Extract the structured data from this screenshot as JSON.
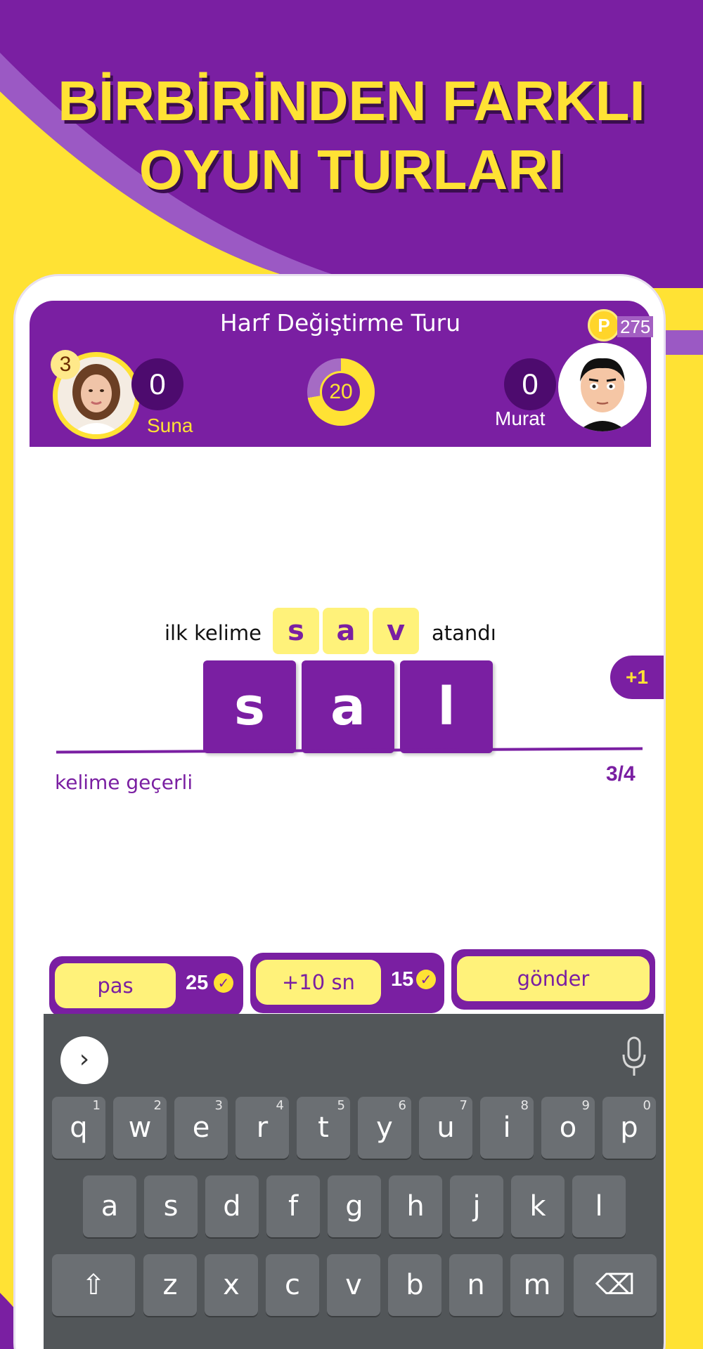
{
  "headline": {
    "line1": "BİRBİRİNDEN FARKLI",
    "line2": "OYUN TURLARI"
  },
  "game": {
    "round_title": "Harf Değiştirme Turu",
    "coin_symbol": "P",
    "coins": "275",
    "timer": "20",
    "player_left": {
      "name": "Suna",
      "score": "0",
      "level": "3"
    },
    "player_right": {
      "name": "Murat",
      "score": "0"
    }
  },
  "word": {
    "prompt_prefix": "ilk kelime",
    "prompt_suffix": "atandı",
    "first_word": [
      "s",
      "a",
      "v"
    ],
    "current_word": [
      "s",
      "a",
      "l"
    ],
    "bonus": "+1",
    "status": "kelime geçerli",
    "progress": "3/4"
  },
  "actions": {
    "pass": {
      "label": "pas",
      "cost": "25"
    },
    "extra_time": {
      "label": "+10 sn",
      "cost": "15"
    },
    "submit": {
      "label": "gönder"
    }
  },
  "keyboard": {
    "expand_glyph": "›",
    "row1": [
      {
        "k": "q",
        "h": "1"
      },
      {
        "k": "w",
        "h": "2"
      },
      {
        "k": "e",
        "h": "3"
      },
      {
        "k": "r",
        "h": "4"
      },
      {
        "k": "t",
        "h": "5"
      },
      {
        "k": "y",
        "h": "6"
      },
      {
        "k": "u",
        "h": "7"
      },
      {
        "k": "i",
        "h": "8"
      },
      {
        "k": "o",
        "h": "9"
      },
      {
        "k": "p",
        "h": "0"
      }
    ],
    "row2": [
      "a",
      "s",
      "d",
      "f",
      "g",
      "h",
      "j",
      "k",
      "l"
    ],
    "row3": [
      "z",
      "x",
      "c",
      "v",
      "b",
      "n",
      "m"
    ],
    "shift_glyph": "⇧",
    "backspace_glyph": "⌫"
  },
  "colors": {
    "purple": "#7a1fa2",
    "yellow": "#ffe234",
    "tile_yellow": "#fff27a",
    "keyboard": "#525659"
  }
}
